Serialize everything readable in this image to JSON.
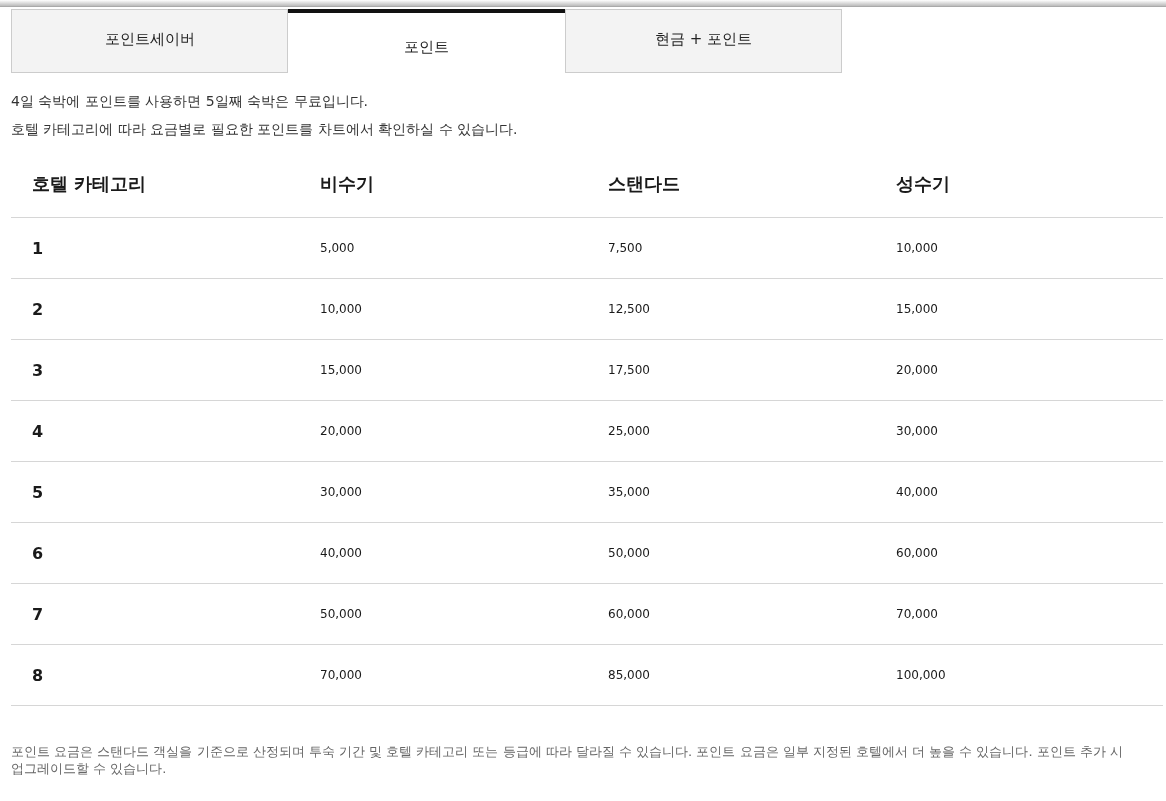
{
  "tabs": [
    {
      "label": "포인트세이버",
      "selected": false
    },
    {
      "label": "포인트",
      "selected": true
    },
    {
      "label": "현금 + 포인트",
      "selected": false
    }
  ],
  "intro": [
    "4일 숙박에 포인트를 사용하면 5일째 숙박은 무료입니다.",
    "호텔 카테고리에 따라 요금별로 필요한 포인트를 차트에서 확인하실 수 있습니다."
  ],
  "table": {
    "columns": [
      "호텔 카테고리",
      "비수기",
      "스탠다드",
      "성수기"
    ],
    "rows": [
      [
        "1",
        "5,000",
        "7,500",
        "10,000"
      ],
      [
        "2",
        "10,000",
        "12,500",
        "15,000"
      ],
      [
        "3",
        "15,000",
        "17,500",
        "20,000"
      ],
      [
        "4",
        "20,000",
        "25,000",
        "30,000"
      ],
      [
        "5",
        "30,000",
        "35,000",
        "40,000"
      ],
      [
        "6",
        "40,000",
        "50,000",
        "60,000"
      ],
      [
        "7",
        "50,000",
        "60,000",
        "70,000"
      ],
      [
        "8",
        "70,000",
        "85,000",
        "100,000"
      ]
    ]
  },
  "footnote": "포인트 요금은 스탠다드 객실을 기준으로 산정되며 투숙 기간 및 호텔 카테고리 또는 등급에 따라 달라질 수 있습니다. 포인트 요금은 일부 지정된 호텔에서 더 높을 수 있습니다. 포인트 추가 시 업그레이드할 수 있습니다."
}
